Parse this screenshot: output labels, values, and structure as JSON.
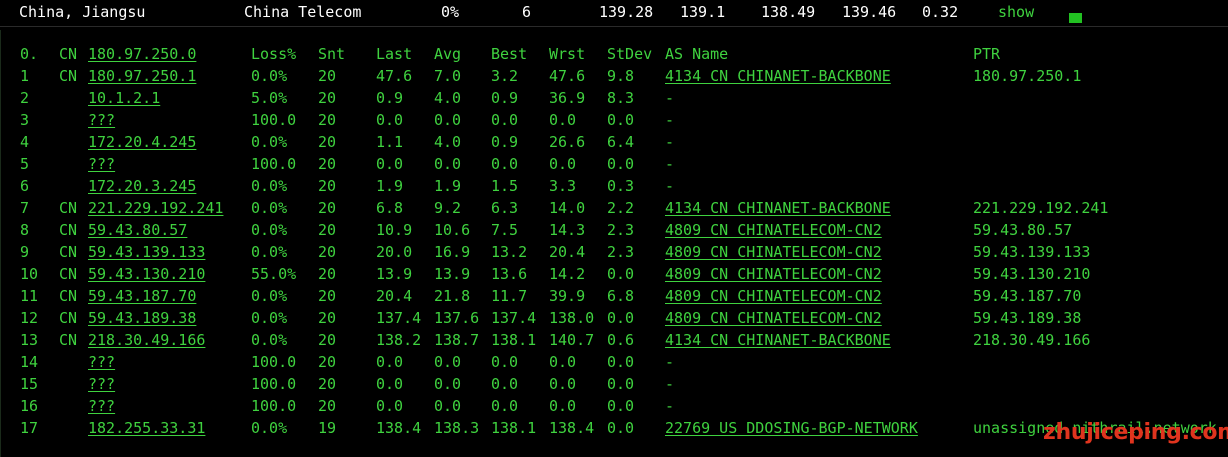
{
  "summary": {
    "location": "China, Jiangsu",
    "isp": "China Telecom",
    "loss": "0%",
    "sent": "6",
    "last": "139.28",
    "avg": "139.1",
    "best": "138.49",
    "worst": "139.46",
    "stdev": "0.32",
    "show_label": "show",
    "indicator_color": "#22c122"
  },
  "columns": {
    "hop": "0.",
    "cc": "CN",
    "host": "180.97.250.0",
    "loss": "Loss%",
    "snt": "Snt",
    "last": "Last",
    "avg": "Avg",
    "best": "Best",
    "wrst": "Wrst",
    "stdev": "StDev",
    "as_name": "AS Name",
    "ptr": "PTR"
  },
  "hops": [
    {
      "hop": "1",
      "cc": "CN",
      "host": "180.97.250.1",
      "loss": "0.0%",
      "snt": "20",
      "last": "47.6",
      "avg": "7.0",
      "best": "3.2",
      "wrst": "47.6",
      "stdev": "9.8",
      "as_name": "4134  CN CHINANET-BACKBONE",
      "ptr": "180.97.250.1"
    },
    {
      "hop": "2",
      "cc": "",
      "host": "10.1.2.1",
      "loss": "5.0%",
      "snt": "20",
      "last": "0.9",
      "avg": "4.0",
      "best": "0.9",
      "wrst": "36.9",
      "stdev": "8.3",
      "as_name": "-",
      "ptr": ""
    },
    {
      "hop": "3",
      "cc": "",
      "host": "???",
      "loss": "100.0",
      "snt": "20",
      "last": "0.0",
      "avg": "0.0",
      "best": "0.0",
      "wrst": "0.0",
      "stdev": "0.0",
      "as_name": "-",
      "ptr": ""
    },
    {
      "hop": "4",
      "cc": "",
      "host": "172.20.4.245",
      "loss": "0.0%",
      "snt": "20",
      "last": "1.1",
      "avg": "4.0",
      "best": "0.9",
      "wrst": "26.6",
      "stdev": "6.4",
      "as_name": "-",
      "ptr": ""
    },
    {
      "hop": "5",
      "cc": "",
      "host": "???",
      "loss": "100.0",
      "snt": "20",
      "last": "0.0",
      "avg": "0.0",
      "best": "0.0",
      "wrst": "0.0",
      "stdev": "0.0",
      "as_name": "-",
      "ptr": ""
    },
    {
      "hop": "6",
      "cc": "",
      "host": "172.20.3.245",
      "loss": "0.0%",
      "snt": "20",
      "last": "1.9",
      "avg": "1.9",
      "best": "1.5",
      "wrst": "3.3",
      "stdev": "0.3",
      "as_name": "-",
      "ptr": ""
    },
    {
      "hop": "7",
      "cc": "CN",
      "host": "221.229.192.241",
      "loss": "0.0%",
      "snt": "20",
      "last": "6.8",
      "avg": "9.2",
      "best": "6.3",
      "wrst": "14.0",
      "stdev": "2.2",
      "as_name": "4134  CN CHINANET-BACKBONE",
      "ptr": "221.229.192.241"
    },
    {
      "hop": "8",
      "cc": "CN",
      "host": "59.43.80.57",
      "loss": "0.0%",
      "snt": "20",
      "last": "10.9",
      "avg": "10.6",
      "best": "7.5",
      "wrst": "14.3",
      "stdev": "2.3",
      "as_name": "4809  CN CHINATELECOM-CN2",
      "ptr": "59.43.80.57"
    },
    {
      "hop": "9",
      "cc": "CN",
      "host": "59.43.139.133",
      "loss": "0.0%",
      "snt": "20",
      "last": "20.0",
      "avg": "16.9",
      "best": "13.2",
      "wrst": "20.4",
      "stdev": "2.3",
      "as_name": "4809  CN CHINATELECOM-CN2",
      "ptr": "59.43.139.133"
    },
    {
      "hop": "10",
      "cc": "CN",
      "host": "59.43.130.210",
      "loss": "55.0%",
      "snt": "20",
      "last": "13.9",
      "avg": "13.9",
      "best": "13.6",
      "wrst": "14.2",
      "stdev": "0.0",
      "as_name": "4809  CN CHINATELECOM-CN2",
      "ptr": "59.43.130.210"
    },
    {
      "hop": "11",
      "cc": "CN",
      "host": "59.43.187.70",
      "loss": "0.0%",
      "snt": "20",
      "last": "20.4",
      "avg": "21.8",
      "best": "11.7",
      "wrst": "39.9",
      "stdev": "6.8",
      "as_name": "4809  CN CHINATELECOM-CN2",
      "ptr": "59.43.187.70"
    },
    {
      "hop": "12",
      "cc": "CN",
      "host": "59.43.189.38",
      "loss": "0.0%",
      "snt": "20",
      "last": "137.4",
      "avg": "137.6",
      "best": "137.4",
      "wrst": "138.0",
      "stdev": "0.0",
      "as_name": "4809  CN CHINATELECOM-CN2",
      "ptr": "59.43.189.38"
    },
    {
      "hop": "13",
      "cc": "CN",
      "host": "218.30.49.166",
      "loss": "0.0%",
      "snt": "20",
      "last": "138.2",
      "avg": "138.7",
      "best": "138.1",
      "wrst": "140.7",
      "stdev": "0.6",
      "as_name": "4134  CN CHINANET-BACKBONE",
      "ptr": "218.30.49.166"
    },
    {
      "hop": "14",
      "cc": "",
      "host": "???",
      "loss": "100.0",
      "snt": "20",
      "last": "0.0",
      "avg": "0.0",
      "best": "0.0",
      "wrst": "0.0",
      "stdev": "0.0",
      "as_name": "-",
      "ptr": ""
    },
    {
      "hop": "15",
      "cc": "",
      "host": "???",
      "loss": "100.0",
      "snt": "20",
      "last": "0.0",
      "avg": "0.0",
      "best": "0.0",
      "wrst": "0.0",
      "stdev": "0.0",
      "as_name": "-",
      "ptr": ""
    },
    {
      "hop": "16",
      "cc": "",
      "host": "???",
      "loss": "100.0",
      "snt": "20",
      "last": "0.0",
      "avg": "0.0",
      "best": "0.0",
      "wrst": "0.0",
      "stdev": "0.0",
      "as_name": "-",
      "ptr": ""
    },
    {
      "hop": "17",
      "cc": "",
      "host": "182.255.33.31",
      "loss": "0.0%",
      "snt": "19",
      "last": "138.4",
      "avg": "138.3",
      "best": "138.1",
      "wrst": "138.4",
      "stdev": "0.0",
      "as_name": "22769 US DDOSING-BGP-NETWORK",
      "ptr": "unassigned.nithrail.network"
    }
  ],
  "watermark": "zhujiceping.com",
  "colors": {
    "background": "#000000",
    "text_green": "#3fd23f",
    "header_text": "#ffffff",
    "watermark": "#e0341e"
  }
}
